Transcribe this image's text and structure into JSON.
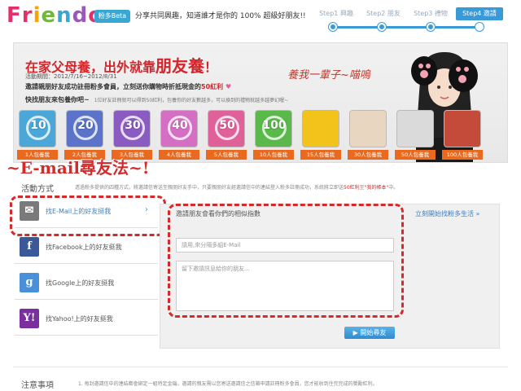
{
  "header": {
    "logo": {
      "letters": [
        "F",
        "r",
        "i",
        "e",
        "n",
        "d",
        "o"
      ],
      "colors": [
        "#e1306c",
        "#e1306c",
        "#f7a400",
        "#6fb83b",
        "#39a7d4",
        "#9b59b6",
        "#e1306c"
      ]
    },
    "beta_badge": "粉多Beta",
    "slogan": "分享共同興趣，知道誰才是你的 100% 超級好朋友!!",
    "steps": [
      {
        "label": "Step1 興趣",
        "active": false
      },
      {
        "label": "Step2 朋友",
        "active": false
      },
      {
        "label": "Step3 禮物",
        "active": false
      },
      {
        "label": "Step4 邀請",
        "active": true
      }
    ]
  },
  "banner": {
    "title_prefix": "在家父母養，出外就靠",
    "title_highlight": "朋友養",
    "title_suffix": "！",
    "period": "活動期間：2012/7/16~2012/8/31",
    "subtitle_prefix": "邀請親朋好友成功註冊粉多會員，立刻送你購物時折抵現金的",
    "subtitle_highlight": "50紅利",
    "subtitle2": "快找朋友來包養你吧~",
    "subtitle2_small": "1位好友註冊就可以得到50紅利，包養你的好友數越多，可以換到的禮物就越多越夢幻喔~",
    "speech": "養我一輩子~喵嗚",
    "tiers": [
      {
        "num": "10",
        "label": "1人包養我",
        "color": "#4aa7d8"
      },
      {
        "num": "20",
        "label": "2人包養我",
        "color": "#5b74c9"
      },
      {
        "num": "30",
        "label": "3人包養我",
        "color": "#8a5cc2"
      },
      {
        "num": "40",
        "label": "4人包養我",
        "color": "#d56fc4"
      },
      {
        "num": "50",
        "label": "5人包養我",
        "color": "#e0609a"
      },
      {
        "num": "100",
        "label": "10人包養我",
        "color": "#5ab94a"
      },
      {
        "num": "",
        "label": "15人包養我",
        "color": "#f2c41b"
      },
      {
        "num": "",
        "label": "30人包養我",
        "color": "#e8d6c0"
      },
      {
        "num": "",
        "label": "50人包養我",
        "color": "#dadada"
      },
      {
        "num": "",
        "label": "100人包養我",
        "color": "#c44a3a"
      }
    ]
  },
  "overlay": {
    "text": "~E-mail尋友法~!"
  },
  "activity": {
    "label": "活動方式",
    "desc_prefix": "透過粉多提供的四種方式，將邀請信寄送至親朋好友手中，只要親朋好友經邀請信中的連結登入粉多註冊成功，系統將立即送",
    "desc_highlight": "50紅利",
    "desc_mid": "至",
    "desc_highlight2": "\"我的帳本\"",
    "desc_suffix": "中。"
  },
  "sidebar": {
    "items": [
      {
        "label": "找E-Mail上的好友挺我",
        "icon": "mail-icon",
        "glyph": "✉",
        "color": "#7a7a7a",
        "active": true
      },
      {
        "label": "找Facebook上的好友挺我",
        "icon": "facebook-icon",
        "glyph": "f",
        "color": "#3b5998",
        "active": false
      },
      {
        "label": "找Google上的好友挺我",
        "icon": "google-icon",
        "glyph": "g",
        "color": "#4a90d9",
        "active": false
      },
      {
        "label": "找Yahoo!上的好友挺我",
        "icon": "yahoo-icon",
        "glyph": "Y!",
        "color": "#7b2f9e",
        "active": false
      }
    ]
  },
  "panel": {
    "title": "邀請朋友會看你們的相似指數",
    "link": "立刻開始找粉多生活 »",
    "email_placeholder": "請用,來分隔多組E-Mail",
    "message_placeholder": "留下邀請訊息給你的朋友...",
    "button": "開始尋友"
  },
  "notes": {
    "label": "注意事項",
    "text": "1. 每封邀請信中的連結都會綁定一組特定金鑰，邀請的親友需以您寄送邀請信之信箱申請註冊粉多會員，您才能收到住完完成的獎勵紅利。"
  }
}
